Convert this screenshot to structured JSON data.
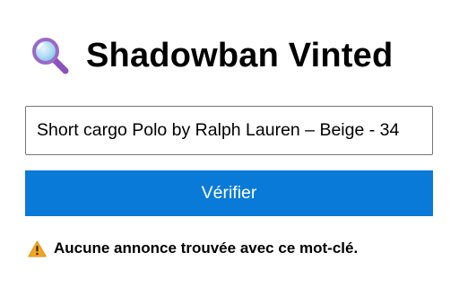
{
  "header": {
    "icon": "magnifying-glass-icon",
    "title": "Shadowban Vinted"
  },
  "search": {
    "value": "Short cargo Polo by Ralph Lauren – Beige - 34"
  },
  "actions": {
    "verify_label": "Vérifier"
  },
  "status": {
    "icon": "warning-icon",
    "message": "Aucune annonce trouvée avec ce mot-clé."
  },
  "colors": {
    "button_background": "#0a7ad8",
    "button_text": "#ffffff",
    "warning": "#f4a623",
    "icon_lens_ring": "#9b69c8",
    "icon_handle": "#8a52bd"
  }
}
